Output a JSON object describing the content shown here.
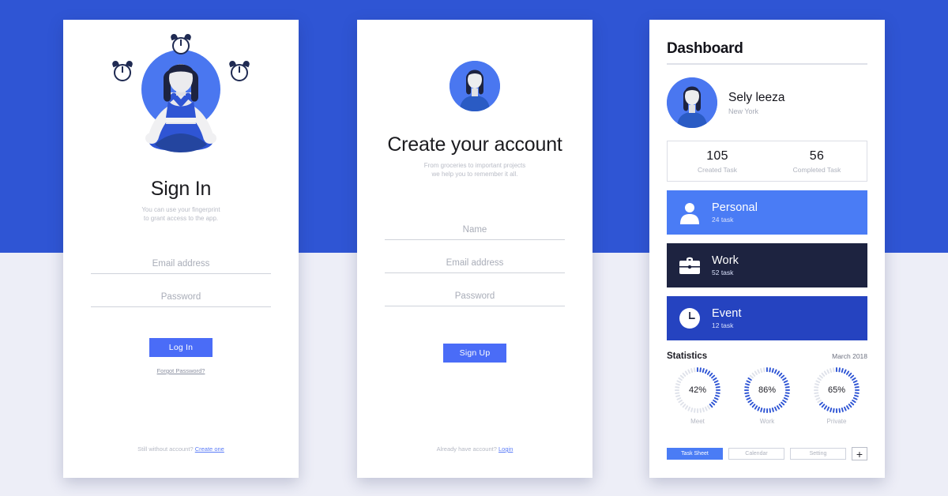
{
  "theme": {
    "band_blue": "#2f55d4",
    "page_bg": "#edeef7",
    "accent_blue": "#4a6cf7",
    "card_personal": "#4a7cf5",
    "card_work": "#1d2340",
    "card_event": "#2543c0"
  },
  "signin": {
    "title": "Sign In",
    "subtitle_line1": "You can use your fingerprint",
    "subtitle_line2": "to grant access to the app.",
    "email_placeholder": "Email address",
    "password_placeholder": "Password",
    "login_button": "Log In",
    "forgot_link": "Forgot Password?",
    "footer_text": "Still without account?",
    "footer_link": "Create one",
    "icons": {
      "clock_top": "alarm-clock-icon",
      "clock_left": "alarm-clock-icon",
      "clock_right": "alarm-clock-icon",
      "figure": "yoga-meditation-illustration"
    }
  },
  "signup": {
    "title": "Create your account",
    "subtitle_line1": "From groceries to important projects",
    "subtitle_line2": "we help you to remember it all.",
    "name_placeholder": "Name",
    "email_placeholder": "Email address",
    "password_placeholder": "Password",
    "signup_button": "Sign Up",
    "footer_text": "Already have account?",
    "footer_link": "Login",
    "avatar_icon": "user-avatar-icon"
  },
  "dashboard": {
    "title": "Dashboard",
    "user": {
      "name": "Sely leeza",
      "location": "New York",
      "avatar_icon": "user-avatar-icon"
    },
    "stats": [
      {
        "number": "105",
        "label": "Created Task"
      },
      {
        "number": "56",
        "label": "Completed Task"
      }
    ],
    "categories": [
      {
        "name": "Personal",
        "count": "24 task",
        "icon": "person-icon",
        "color": "#4a7cf5"
      },
      {
        "name": "Work",
        "count": "52 task",
        "icon": "briefcase-icon",
        "color": "#1d2340"
      },
      {
        "name": "Event",
        "count": "12 task",
        "icon": "clock-icon",
        "color": "#2543c0"
      }
    ],
    "statistics": {
      "heading": "Statistics",
      "date": "March 2018",
      "rings": [
        {
          "percent": "42%",
          "label": "Meet",
          "value": 42
        },
        {
          "percent": "86%",
          "label": "Work",
          "value": 86
        },
        {
          "percent": "65%",
          "label": "Private",
          "value": 65
        }
      ]
    },
    "tabs": [
      {
        "label": "Task Sheet",
        "active": true
      },
      {
        "label": "Calendar",
        "active": false
      },
      {
        "label": "Setting",
        "active": false
      }
    ],
    "add_button": "+"
  }
}
